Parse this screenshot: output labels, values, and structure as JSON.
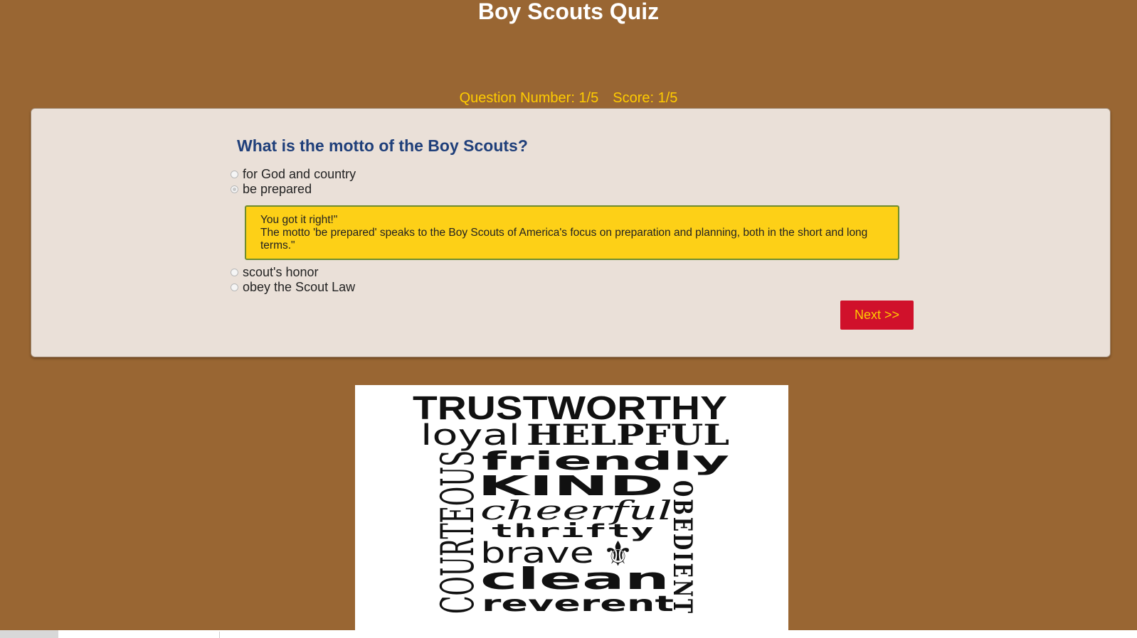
{
  "page": {
    "title": "Boy Scouts Quiz"
  },
  "status": {
    "question_number": "Question Number: 1/5",
    "score": "Score: 1/5"
  },
  "quiz": {
    "question": "What is the motto of the Boy Scouts?",
    "options": [
      {
        "label": "for God and country",
        "checked": false
      },
      {
        "label": "be prepared",
        "checked": true
      },
      {
        "label": "scout's honor",
        "checked": false
      },
      {
        "label": "obey the Scout Law",
        "checked": false
      }
    ],
    "feedback": {
      "line1": "You got it right!\"",
      "line2": "The motto 'be prepared' speaks to the Boy Scouts of America's focus on preparation and planning, both in the short and long terms.\""
    },
    "next_label": "Next >>"
  },
  "image": {
    "words": {
      "trustworthy": "TRUSTWORTHY",
      "loyal": "loyal",
      "helpful": "HELPFUL",
      "friendly": "friendly",
      "kind": "KIND",
      "cheerful": "cheerful",
      "thrifty": "thrifty",
      "brave": "brave",
      "clean": "clean",
      "reverent": "reverent",
      "courteous": "COURTEOUS",
      "obedient": "OBEDIENT"
    },
    "fleur_symbol": "⚜"
  },
  "colors": {
    "background": "#996633",
    "title": "#ffffff",
    "status": "#ffcc00",
    "panel": "#eae0d8",
    "question": "#1f3f7a",
    "feedback_bg": "#fdd017",
    "feedback_border": "#6e8c2f",
    "next_bg": "#d0112b",
    "next_text": "#ffcc00"
  },
  "icons": {
    "radio": "radio-circle-icon",
    "fleur": "fleur-de-lis-icon"
  }
}
